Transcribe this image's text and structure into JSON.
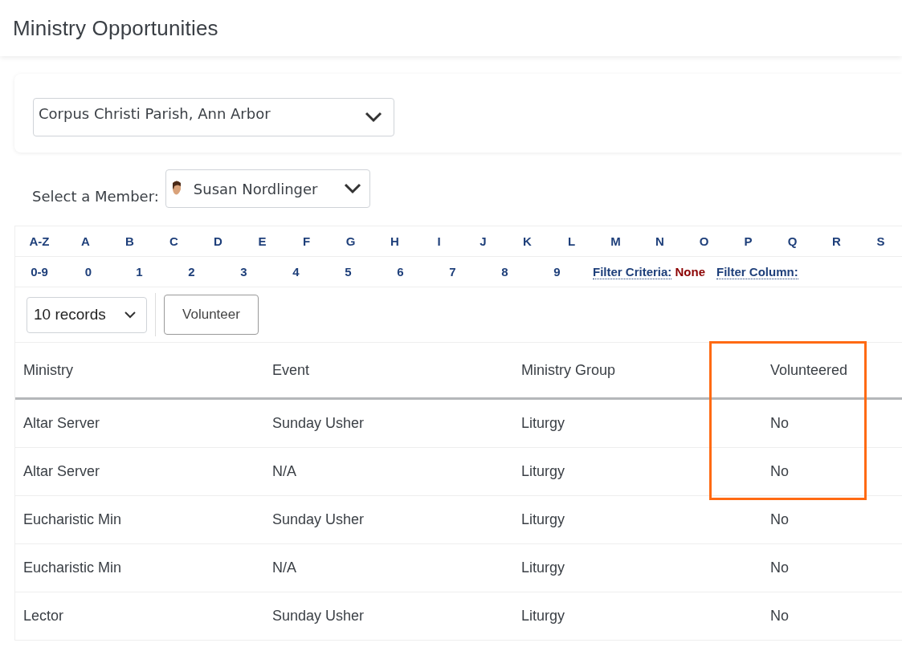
{
  "page_title": "Ministry Opportunities",
  "parish_select": {
    "value": "Corpus Christi Parish, Ann Arbor"
  },
  "member_select": {
    "label": "Select a Member:",
    "value": "Susan Nordlinger"
  },
  "letter_filter": [
    "A-Z",
    "A",
    "B",
    "C",
    "D",
    "E",
    "F",
    "G",
    "H",
    "I",
    "J",
    "K",
    "L",
    "M",
    "N",
    "O",
    "P",
    "Q",
    "R",
    "S"
  ],
  "digit_filter": [
    "0-9",
    "0",
    "1",
    "2",
    "3",
    "4",
    "5",
    "6",
    "7",
    "8",
    "9"
  ],
  "filter_criteria": {
    "label": "Filter Criteria:",
    "value": "None"
  },
  "filter_column": {
    "label": "Filter Column:"
  },
  "records_select": {
    "value": "10 records"
  },
  "volunteer_button": "Volunteer",
  "table": {
    "columns": [
      "Ministry",
      "Event",
      "Ministry Group",
      "Volunteered"
    ],
    "rows": [
      [
        "Altar Server",
        "Sunday Usher",
        "Liturgy",
        "No"
      ],
      [
        "Altar Server",
        "N/A",
        "Liturgy",
        "No"
      ],
      [
        "Eucharistic Min",
        "Sunday Usher",
        "Liturgy",
        "No"
      ],
      [
        "Eucharistic Min",
        "N/A",
        "Liturgy",
        "No"
      ],
      [
        "Lector",
        "Sunday Usher",
        "Liturgy",
        "No"
      ]
    ]
  }
}
